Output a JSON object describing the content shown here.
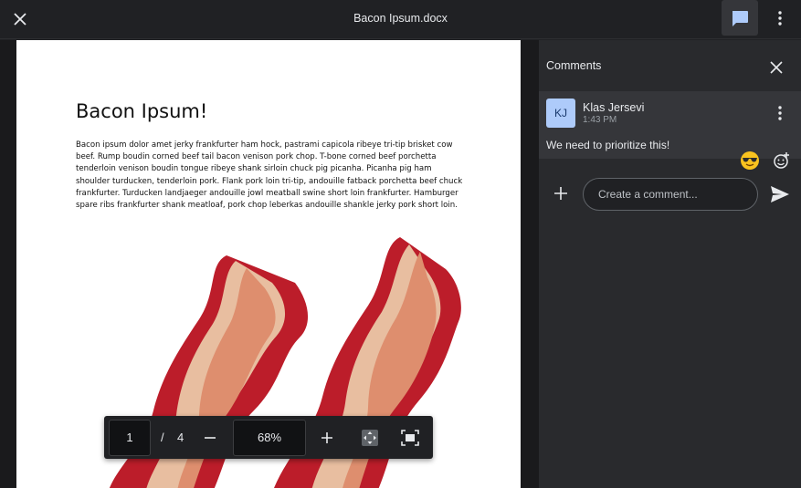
{
  "window": {
    "title": "Bacon Ipsum.docx",
    "close_icon": "close-icon",
    "comments_icon": "comment-icon",
    "more_icon": "more-vert-icon",
    "accent": "#aecbfa"
  },
  "document": {
    "title": "Bacon Ipsum!",
    "body": "Bacon ipsum dolor amet jerky frankfurter ham hock, pastrami capicola ribeye tri-tip brisket cow beef. Rump boudin corned beef tail bacon venison pork chop. T-bone corned beef porchetta tenderloin venison boudin tongue ribeye shank sirloin chuck pig picanha. Picanha pig ham shoulder turducken, tenderloin pork. Flank pork loin tri-tip, andouille fatback porchetta beef chuck frankfurter. Turducken landjaeger andouille jowl meatball swine short loin frankfurter. Hamburger spare ribs frankfurter shank meatloaf, pork chop leberkas andouille shankle jerky pork short loin.",
    "image": "bacon-strips-illustration"
  },
  "toolbar": {
    "page": "1",
    "separator": "/",
    "total_pages": "4",
    "zoom": "68%",
    "zoom_out_icon": "minus-icon",
    "zoom_in_icon": "plus-icon",
    "fit_icon": "fit-to-page-icon",
    "fullscreen_icon": "fullscreen-icon"
  },
  "comments": {
    "header": "Comments",
    "items": [
      {
        "initials": "KJ",
        "author": "Klas Jersevi",
        "time": "1:43 PM",
        "text": "We need to prioritize this!",
        "reaction": "😎"
      }
    ],
    "input_placeholder": "Create a comment...",
    "add_icon": "plus-icon",
    "send_icon": "send-icon",
    "add_reaction_icon": "add-reaction-icon"
  }
}
